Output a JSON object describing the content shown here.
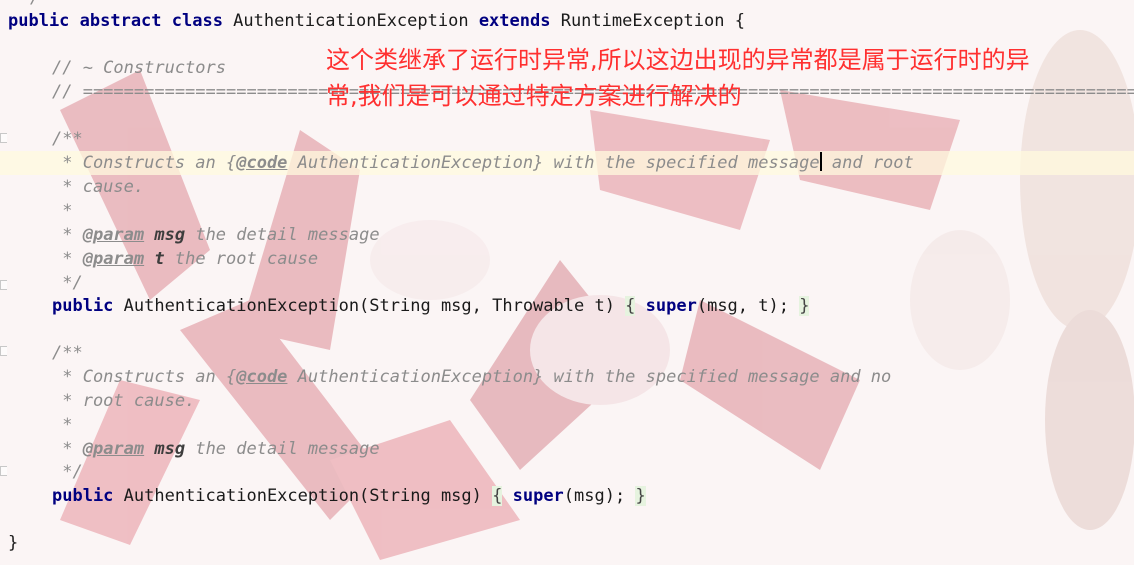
{
  "code": {
    "l0": "/",
    "l1": {
      "kw1": "public abstract class",
      "name": " AuthenticationException ",
      "kw2": "extends",
      "rest": " RuntimeException {"
    },
    "l2": "// ~ Constructors",
    "l3": "// ==========================================================================================================",
    "l4": "/**",
    "l5": {
      "a": " * Constructs an {",
      "tag": "@code",
      "b": " AuthenticationException} with the specified message",
      "c": " and root"
    },
    "l6": " * cause.",
    "l7": " *",
    "l8": {
      "a": " * ",
      "tag": "@param",
      "pn": " msg",
      "b": " the detail message"
    },
    "l9": {
      "a": " * ",
      "tag": "@param",
      "pn": " t",
      "b": " the root cause"
    },
    "l10": " */",
    "l11": {
      "kw": "public",
      "sig": " AuthenticationException(String msg, Throwable t) ",
      "open": "{",
      "kw2": " super",
      "args": "(msg, t); ",
      "close": "}"
    },
    "l12": "/**",
    "l13": {
      "a": " * Constructs an {",
      "tag": "@code",
      "b": " AuthenticationException} with the specified message and no"
    },
    "l14": " * root cause.",
    "l15": " *",
    "l16": {
      "a": " * ",
      "tag": "@param",
      "pn": " msg",
      "b": " the detail message"
    },
    "l17": " */",
    "l18": {
      "kw": "public",
      "sig": " AuthenticationException(String msg) ",
      "open": "{",
      "kw2": " super",
      "args": "(msg); ",
      "close": "}"
    },
    "l19": "}"
  },
  "annotation": {
    "line1": "这个类继承了运行时异常,所以这边出现的异常都是属于运行时的异",
    "line2": "常,我们是可以通过特定方案进行解决的"
  },
  "colors": {
    "keyword": "#000080",
    "comment": "#8c8c8c",
    "annotation": "#ff3030",
    "brace_bg": "#e6f3df"
  }
}
